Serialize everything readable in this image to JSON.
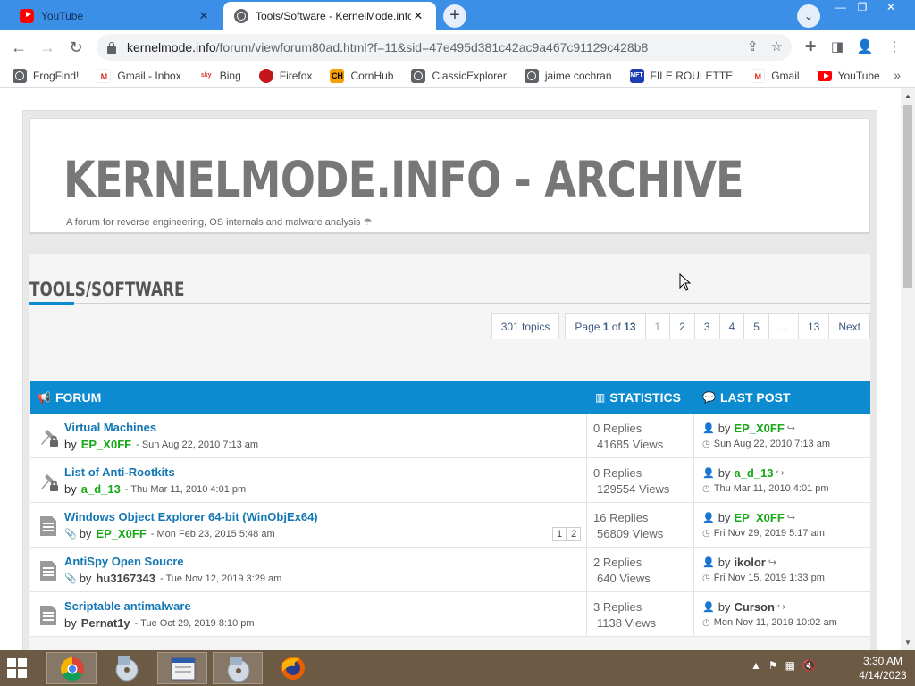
{
  "browser": {
    "tabs": [
      {
        "title": "YouTube",
        "icon": "youtube-icon",
        "active": false
      },
      {
        "title": "Tools/Software - KernelMode.info",
        "icon": "globe-icon",
        "active": true
      }
    ],
    "url_host": "kernelmode.info",
    "url_path": "/forum/viewforum80ad.html?f=11&sid=47e495d381c42ac9a467c91129c428b8",
    "bookmarks": [
      {
        "label": "FrogFind!",
        "icon": "globe-icon"
      },
      {
        "label": "Gmail - Inbox",
        "icon": "gmail-icon"
      },
      {
        "label": "Bing",
        "icon": "bing-icon"
      },
      {
        "label": "Firefox",
        "icon": "firefox-icon"
      },
      {
        "label": "CornHub",
        "icon": "cornhub-icon"
      },
      {
        "label": "ClassicExplorer",
        "icon": "globe-icon"
      },
      {
        "label": "jaime cochran",
        "icon": "globe-icon"
      },
      {
        "label": "FILE ROULETTE",
        "icon": "file-roulette-icon"
      },
      {
        "label": "Gmail",
        "icon": "gmail-icon"
      },
      {
        "label": "YouTube",
        "icon": "youtube-icon"
      }
    ],
    "bookmark_more": "»"
  },
  "site": {
    "title": "KERNELMODE.INFO - ARCHIVE",
    "description": "A forum for reverse engineering, OS internals and malware analysis"
  },
  "forum": {
    "heading": "TOOLS/SOFTWARE",
    "pagination": {
      "topics": "301 topics",
      "page_prefix": "Page",
      "page_current": "1",
      "page_of": "of",
      "page_total": "13",
      "pages": [
        "1",
        "2",
        "3",
        "4",
        "5",
        "…",
        "13"
      ],
      "next": "Next"
    },
    "columns": {
      "forum": "FORUM",
      "statistics": "STATISTICS",
      "last_post": "LAST POST"
    },
    "topics": [
      {
        "title": "Virtual Machines",
        "author": "EP_X0FF",
        "author_color": "green",
        "date": "- Sun Aug 22, 2010 7:13 am",
        "replies": "0 Replies",
        "views": "41685 Views",
        "last_author": "EP_X0FF",
        "last_color": "green",
        "last_date": "Sun Aug 22, 2010 7:13 am",
        "icon": "sticky-locked-icon",
        "attachment": false,
        "pages": []
      },
      {
        "title": "List of Anti-Rootkits",
        "author": "a_d_13",
        "author_color": "green",
        "date": "- Thu Mar 11, 2010 4:01 pm",
        "replies": "0 Replies",
        "views": "129554 Views",
        "last_author": "a_d_13",
        "last_color": "green",
        "last_date": "Thu Mar 11, 2010 4:01 pm",
        "icon": "sticky-locked-icon",
        "attachment": false,
        "pages": []
      },
      {
        "title": "Windows Object Explorer 64-bit (WinObjEx64)",
        "author": "EP_X0FF",
        "author_color": "green",
        "date": "- Mon Feb 23, 2015 5:48 am",
        "replies": "16 Replies",
        "views": "56809 Views",
        "last_author": "EP_X0FF",
        "last_color": "green",
        "last_date": "Fri Nov 29, 2019 5:17 am",
        "icon": "topic-icon",
        "attachment": true,
        "pages": [
          "1",
          "2"
        ]
      },
      {
        "title": "AntiSpy Open Soucre",
        "author": "hu3167343",
        "author_color": "dark",
        "date": "- Tue Nov 12, 2019 3:29 am",
        "replies": "2 Replies",
        "views": "640 Views",
        "last_author": "ikolor",
        "last_color": "dark",
        "last_date": "Fri Nov 15, 2019 1:33 pm",
        "icon": "topic-icon",
        "attachment": true,
        "pages": []
      },
      {
        "title": "Scriptable antimalware",
        "author": "Pernat1y",
        "author_color": "dark",
        "date": "- Tue Oct 29, 2019 8:10 pm",
        "replies": "3 Replies",
        "views": "1138 Views",
        "last_author": "Curson",
        "last_color": "dark",
        "last_date": "Mon Nov 11, 2019 10:02 am",
        "icon": "topic-icon",
        "attachment": false,
        "pages": []
      }
    ]
  },
  "taskbar": {
    "time": "3:30 AM",
    "date": "4/14/2023"
  },
  "colors": {
    "accent": "#0d8bd1",
    "link": "#1477b5",
    "user_green": "#18a818"
  }
}
